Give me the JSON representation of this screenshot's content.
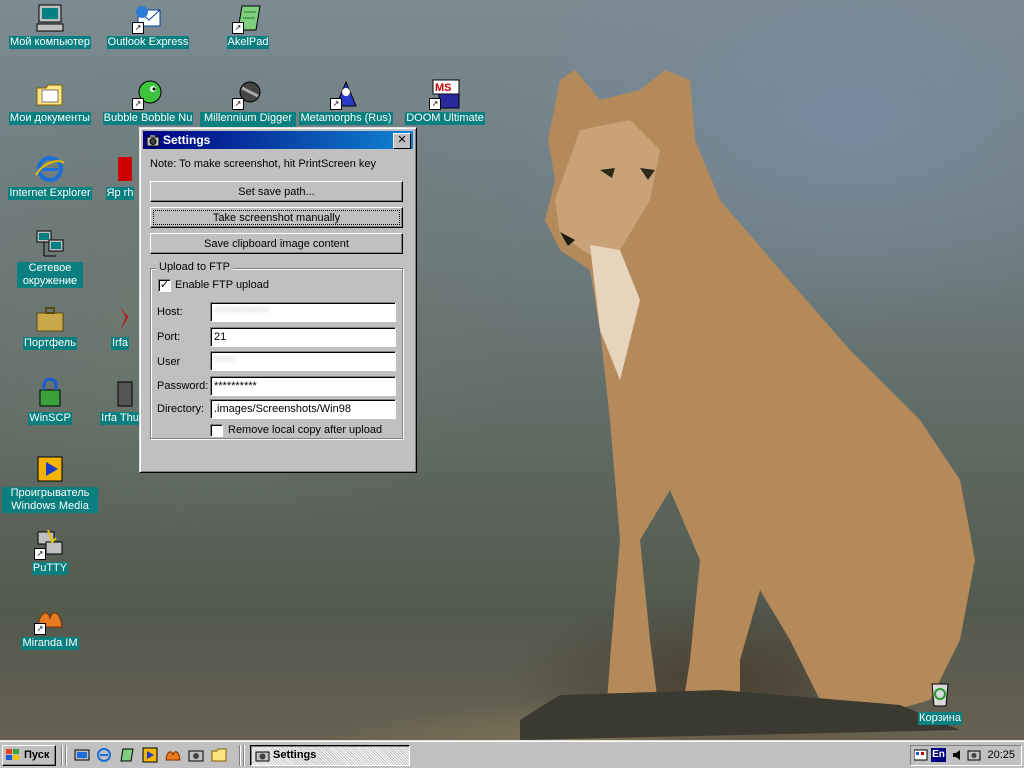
{
  "desktop": {
    "icons": [
      {
        "label": "Мой компьютер"
      },
      {
        "label": "Outlook Express"
      },
      {
        "label": "AkelPad"
      },
      {
        "label": "Мои документы"
      },
      {
        "label": "Bubble Bobble Nu"
      },
      {
        "label": "Millennium Digger -"
      },
      {
        "label": "Metamorphs (Rus)"
      },
      {
        "label": "DOOM Ultimate"
      },
      {
        "label": "Internet Explorer"
      },
      {
        "label": "Яр rh"
      },
      {
        "label": "Сетевое окружение"
      },
      {
        "label": "Портфель"
      },
      {
        "label": "Irfa"
      },
      {
        "label": "WinSCP"
      },
      {
        "label": "Irfa Thu"
      },
      {
        "label": "Проигрыватель Windows Media"
      },
      {
        "label": "PuTTY"
      },
      {
        "label": "Miranda IM"
      },
      {
        "label": "Корзина"
      }
    ]
  },
  "window": {
    "title": "Settings",
    "close_label": "✕",
    "note": "Note: To make screenshot, hit PrintScreen key",
    "buttons": {
      "set_save_path": "Set save path...",
      "take_screenshot": "Take screenshot manually",
      "save_clipboard": "Save clipboard image content"
    },
    "ftp_group": {
      "legend": "Upload to FTP",
      "enable_label": "Enable FTP upload",
      "enable_checked": true,
      "host_label": "Host:",
      "host_value": "*************",
      "port_label": "Port:",
      "port_value": "21",
      "user_label": "User",
      "user_value": "*****",
      "password_label": "Password:",
      "password_value": "**********",
      "directory_label": "Directory:",
      "directory_value": ".images/Screenshots/Win98",
      "remove_label": "Remove local copy after upload",
      "remove_checked": false
    }
  },
  "taskbar": {
    "start_label": "Пуск",
    "task_label": "Settings",
    "lang": "En",
    "clock": "20:25"
  },
  "colors": {
    "titlebar_start": "#000080",
    "titlebar_end": "#1084d0",
    "face": "#c0c0c0",
    "icon_label_bg": "#0a7f7f"
  }
}
